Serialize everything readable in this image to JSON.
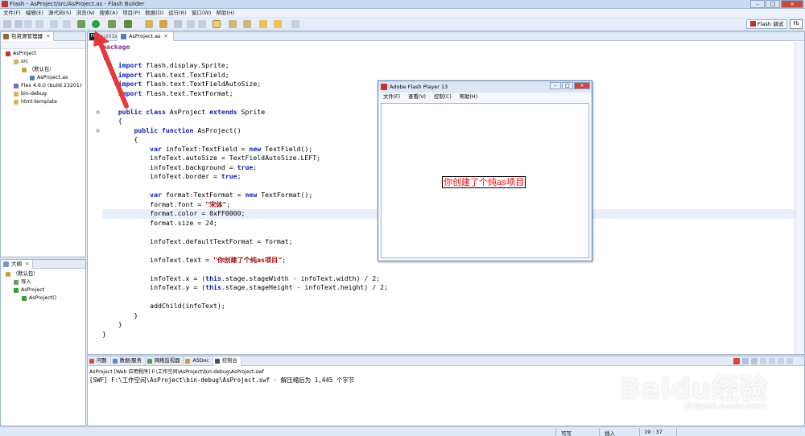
{
  "window": {
    "title": "Flash - AsProject/src/AsProject.as - Flash Builder"
  },
  "menubar": {
    "items": [
      "文件(F)",
      "编辑(E)",
      "源代码(S)",
      "浏览(N)",
      "搜索(A)",
      "项目(P)",
      "数据(D)",
      "运行(R)",
      "窗口(W)",
      "帮助(H)"
    ]
  },
  "toolbar": {
    "perspective_label": "Flash 调试"
  },
  "package_explorer": {
    "tab_label": "包资源管理器",
    "tree": [
      {
        "label": "AsProject",
        "level": 0
      },
      {
        "label": "src",
        "level": 1
      },
      {
        "label": "（默认包）",
        "level": 2
      },
      {
        "label": "AsProject.as",
        "level": 3
      },
      {
        "label": "Flex 4.6.0 (build 23201)",
        "level": 1
      },
      {
        "label": "bin-debug",
        "level": 1
      },
      {
        "label": "html-template",
        "level": 1
      }
    ]
  },
  "outline": {
    "tab_label": "大纲",
    "tree": [
      {
        "label": "（默认包）",
        "level": 0
      },
      {
        "label": "导入",
        "level": 1
      },
      {
        "label": "AsProject",
        "level": 1
      },
      {
        "label": "AsProject()",
        "level": 2
      }
    ]
  },
  "editor": {
    "tab_label": "AsProject.as",
    "code_lines": [
      {
        "segments": [
          {
            "t": "package",
            "c": "kw2"
          }
        ]
      },
      {
        "segments": [
          {
            "t": "{",
            "c": ""
          }
        ]
      },
      {
        "segments": [
          {
            "t": "    ",
            "c": ""
          },
          {
            "t": "import",
            "c": "kw"
          },
          {
            "t": " flash.display.Sprite;",
            "c": ""
          }
        ]
      },
      {
        "segments": [
          {
            "t": "    ",
            "c": ""
          },
          {
            "t": "import",
            "c": "kw"
          },
          {
            "t": " flash.text.TextField;",
            "c": ""
          }
        ]
      },
      {
        "segments": [
          {
            "t": "    ",
            "c": ""
          },
          {
            "t": "import",
            "c": "kw"
          },
          {
            "t": " flash.text.TextFieldAutoSize;",
            "c": ""
          }
        ]
      },
      {
        "segments": [
          {
            "t": "    ",
            "c": ""
          },
          {
            "t": "import",
            "c": "kw"
          },
          {
            "t": " flash.text.TextFormat;",
            "c": ""
          }
        ]
      },
      {
        "segments": []
      },
      {
        "segments": [
          {
            "t": "    ",
            "c": ""
          },
          {
            "t": "public class",
            "c": "kw"
          },
          {
            "t": " AsProject ",
            "c": ""
          },
          {
            "t": "extends",
            "c": "kw"
          },
          {
            "t": " Sprite",
            "c": ""
          }
        ]
      },
      {
        "segments": [
          {
            "t": "    {",
            "c": ""
          }
        ]
      },
      {
        "segments": [
          {
            "t": "        ",
            "c": ""
          },
          {
            "t": "public function",
            "c": "kw"
          },
          {
            "t": " AsProject()",
            "c": ""
          }
        ]
      },
      {
        "segments": [
          {
            "t": "        {",
            "c": ""
          }
        ]
      },
      {
        "segments": [
          {
            "t": "            ",
            "c": ""
          },
          {
            "t": "var",
            "c": "kw"
          },
          {
            "t": " infoText:TextField = ",
            "c": ""
          },
          {
            "t": "new",
            "c": "kw"
          },
          {
            "t": " TextField();",
            "c": ""
          }
        ]
      },
      {
        "segments": [
          {
            "t": "            infoText.autoSize = TextFieldAutoSize.LEFT;",
            "c": ""
          }
        ]
      },
      {
        "segments": [
          {
            "t": "            infoText.background = ",
            "c": ""
          },
          {
            "t": "true",
            "c": "kw"
          },
          {
            "t": ";",
            "c": ""
          }
        ]
      },
      {
        "segments": [
          {
            "t": "            infoText.border = ",
            "c": ""
          },
          {
            "t": "true",
            "c": "kw"
          },
          {
            "t": ";",
            "c": ""
          }
        ]
      },
      {
        "segments": []
      },
      {
        "segments": [
          {
            "t": "            ",
            "c": ""
          },
          {
            "t": "var",
            "c": "kw"
          },
          {
            "t": " format:TextFormat = ",
            "c": ""
          },
          {
            "t": "new",
            "c": "kw"
          },
          {
            "t": " TextFormat();",
            "c": ""
          }
        ]
      },
      {
        "segments": [
          {
            "t": "            format.font = ",
            "c": ""
          },
          {
            "t": "\"宋体\"",
            "c": "str"
          },
          {
            "t": ";",
            "c": ""
          }
        ]
      },
      {
        "segments": [
          {
            "t": "            format.color = 0xFF0000;",
            "c": ""
          }
        ],
        "highlight": true
      },
      {
        "segments": [
          {
            "t": "            format.size = 24;",
            "c": ""
          }
        ]
      },
      {
        "segments": []
      },
      {
        "segments": [
          {
            "t": "            infoText.defaultTextFormat = format;",
            "c": ""
          }
        ]
      },
      {
        "segments": []
      },
      {
        "segments": [
          {
            "t": "            infoText.text = ",
            "c": ""
          },
          {
            "t": "\"你创建了个纯as项目\"",
            "c": "str"
          },
          {
            "t": ";",
            "c": ""
          }
        ]
      },
      {
        "segments": []
      },
      {
        "segments": [
          {
            "t": "            infoText.x = (",
            "c": ""
          },
          {
            "t": "this",
            "c": "kw"
          },
          {
            "t": ".stage.stageWidth - infoText.width) / 2;",
            "c": ""
          }
        ]
      },
      {
        "segments": [
          {
            "t": "            infoText.y = (",
            "c": ""
          },
          {
            "t": "this",
            "c": "kw"
          },
          {
            "t": ".stage.stageHeight - infoText.height) / 2;",
            "c": ""
          }
        ]
      },
      {
        "segments": []
      },
      {
        "segments": [
          {
            "t": "            addChild(infoText);",
            "c": ""
          }
        ]
      },
      {
        "segments": [
          {
            "t": "        }",
            "c": ""
          }
        ]
      },
      {
        "segments": [
          {
            "t": "    }",
            "c": ""
          }
        ]
      },
      {
        "segments": [
          {
            "t": "}",
            "c": ""
          }
        ]
      }
    ]
  },
  "flash_player": {
    "title": "Adobe Flash Player 13",
    "menu": [
      "文件(F)",
      "查看(V)",
      "控制(C)",
      "帮助(H)"
    ],
    "stage_text": "你创建了个纯as项目",
    "stage_text_color": "#ff0000"
  },
  "console": {
    "tabs": [
      "问题",
      "数据/服务",
      "网络监视器",
      "ASDoc",
      "控制台"
    ],
    "header": "AsProject [Web 应用程序] F:\\工作空间\\AsProject\\bin-debug\\AsProject.swf",
    "output": "[SWF] F:\\工作空间\\AsProject\\bin-debug\\AsProject.swf - 解压缩后为 1,445 个字节"
  },
  "statusbar": {
    "writable": "可写",
    "insert_mode": "插入",
    "position": "19 : 37"
  },
  "watermark": {
    "brand": "Baidu经验",
    "url": "jingyan.baidu.com"
  }
}
